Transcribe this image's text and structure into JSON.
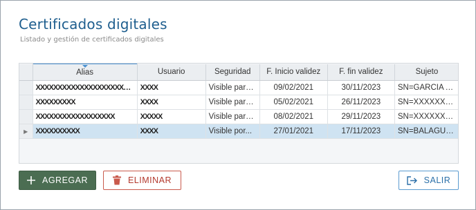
{
  "header": {
    "title": "Certificados digitales",
    "subtitle": "Listado y gestión de certificados digitales"
  },
  "table": {
    "columns": [
      "Alias",
      "Usuario",
      "Seguridad",
      "F. Inicio validez",
      "F. fin validez",
      "Sujeto"
    ],
    "rows": [
      {
        "alias": "XXXXXXXXXXXXXXXXXXXXXXX",
        "usuario": "XXXX",
        "seguridad": "Visible para...",
        "inicio": "09/02/2021",
        "fin": "30/11/2023",
        "sujeto": "SN=GARCIA  A...",
        "selected": false
      },
      {
        "alias": "XXXXXXXXX",
        "usuario": "XXXX",
        "seguridad": "Visible para...",
        "inicio": "05/02/2021",
        "fin": "26/11/2023",
        "sujeto": "SN=XXXXXXXXX",
        "selected": false
      },
      {
        "alias": "XXXXXXXXXXXXXXXXXX",
        "usuario": "XXXXX",
        "seguridad": "Visible para...",
        "inicio": "08/02/2021",
        "fin": "29/11/2023",
        "sujeto": "SN=XXXXXXXXX",
        "selected": false
      },
      {
        "alias": "XXXXXXXXXX",
        "usuario": "XXXX",
        "seguridad": "Visible por...",
        "inicio": "27/01/2021",
        "fin": "17/11/2023",
        "sujeto": "SN=BALAGUE...",
        "selected": true
      }
    ]
  },
  "buttons": {
    "add_label": "AGREGAR",
    "delete_label": "ELIMINAR",
    "exit_label": "SALIR"
  },
  "icons": {
    "add": "plus-icon",
    "delete": "trash-icon",
    "exit": "exit-icon",
    "row_indicator": "triangle-right-icon"
  },
  "colors": {
    "title": "#1e5e8e",
    "add_button": "#4b6d52",
    "delete_button": "#b3382c",
    "exit_button": "#2a6fa8",
    "selected_row": "#cfe3f2"
  }
}
